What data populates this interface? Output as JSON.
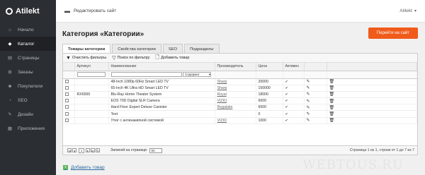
{
  "brand": {
    "name": "Atilekt"
  },
  "sidebar": {
    "items": [
      {
        "label": "Начало",
        "icon": "home-icon",
        "glyph": "⌂"
      },
      {
        "label": "Каталог",
        "icon": "tag-icon",
        "glyph": "◆"
      },
      {
        "label": "Страницы",
        "icon": "pages-icon",
        "glyph": "▤"
      },
      {
        "label": "Заказы",
        "icon": "cart-icon",
        "glyph": "⊞"
      },
      {
        "label": "Покупатели",
        "icon": "users-icon",
        "glyph": "☻"
      },
      {
        "label": "SEO",
        "icon": "chart-icon",
        "glyph": "◔"
      },
      {
        "label": "Дизайн",
        "icon": "brush-icon",
        "glyph": "✎"
      },
      {
        "label": "Приложения",
        "icon": "apps-icon",
        "glyph": "▦"
      }
    ],
    "active_index": 1
  },
  "topbar": {
    "edit_site_label": "Редактировать сайт",
    "user_label": "Atilekt",
    "user_chevron": "▾"
  },
  "page": {
    "title": "Категория «Категории»",
    "goto_site_label": "Перейти на сайт"
  },
  "tabs": [
    {
      "label": "Товары категории",
      "active": true
    },
    {
      "label": "Свойства категории",
      "active": false
    },
    {
      "label": "SEO",
      "active": false
    },
    {
      "label": "Подразделы",
      "active": false
    }
  ],
  "toolbar": {
    "clear_filters": "Очистить фильтры",
    "search_filter": "Поиск по фильтру",
    "add_product": "Добавить товар"
  },
  "table": {
    "headers": [
      "",
      "Артикул",
      "Наименование",
      "Производитель",
      "Цена",
      "Активен",
      "",
      ""
    ],
    "filter_select": "Содержит",
    "rows": [
      {
        "sku": "",
        "name": "48-Inch 1080p 60Hz Smart LED TV",
        "maker": "Sharp",
        "price": "20000",
        "active": true
      },
      {
        "sku": "",
        "name": "65-Inch 4K Ultra HD Smart LED TV",
        "maker": "Sharp",
        "price": "150000",
        "active": true
      },
      {
        "sku": "RX6500",
        "name": "Blu-Ray Home Theater System",
        "maker": "Royal",
        "price": "18000",
        "active": true
      },
      {
        "sku": "",
        "name": "EOS 70D Digital SLR Camera",
        "maker": "VIZIO",
        "price": "6000",
        "active": true
      },
      {
        "sku": "",
        "name": "Hard Floor Expert Deluxe Canister",
        "maker": "Regalake",
        "price": "6500",
        "active": true
      },
      {
        "sku": "",
        "name": "Test",
        "maker": "",
        "price": "0",
        "active": true
      },
      {
        "sku": "",
        "name": "Утюг с антинакипной системой",
        "maker": "VIZIO",
        "price": "1000",
        "active": true
      }
    ]
  },
  "pager": {
    "page": "1",
    "per_page_label": "Записей на странице:",
    "per_page_value": "50",
    "info": "Страница 1 из 1, строки от 1 до 7 из 7"
  },
  "footer": {
    "add_product_link": "Добавить товар"
  },
  "watermark": "WEBTOUS.RU",
  "colors": {
    "sidebar_bg": "#2b2e33",
    "accent_orange": "#f05a1a",
    "add_green": "#5cb85c"
  }
}
